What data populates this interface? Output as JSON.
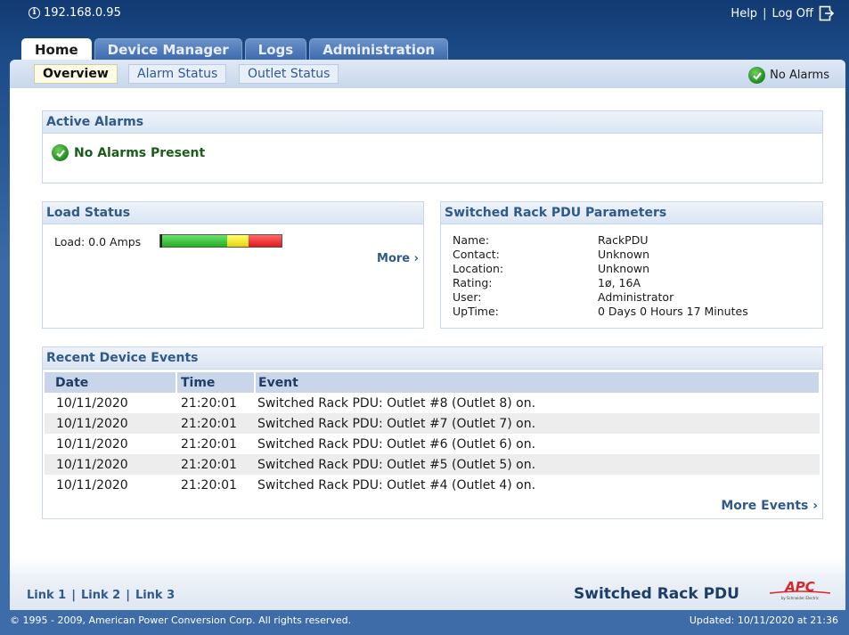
{
  "top": {
    "ip": "192.168.0.95",
    "help": "Help",
    "sep": "|",
    "logoff": "Log Off"
  },
  "tabs": [
    {
      "label": "Home"
    },
    {
      "label": "Device Manager"
    },
    {
      "label": "Logs"
    },
    {
      "label": "Administration"
    }
  ],
  "subtabs": [
    {
      "label": "Overview"
    },
    {
      "label": "Alarm Status"
    },
    {
      "label": "Outlet Status"
    }
  ],
  "alarm_indicator": "No Alarms",
  "active_alarms": {
    "title": "Active Alarms",
    "message": "No Alarms Present"
  },
  "load_status": {
    "title": "Load Status",
    "label": "Load: 0.0 Amps",
    "load_level": 0,
    "more": "More ›"
  },
  "parameters": {
    "title": "Switched Rack PDU Parameters",
    "rows": [
      {
        "key": "Name:",
        "value": "RackPDU"
      },
      {
        "key": "Contact:",
        "value": "Unknown"
      },
      {
        "key": "Location:",
        "value": "Unknown"
      },
      {
        "key": "Rating:",
        "value": "1ø, 16A"
      },
      {
        "key": "User:",
        "value": "Administrator"
      },
      {
        "key": "UpTime:",
        "value": "0 Days 0 Hours 17 Minutes"
      }
    ]
  },
  "events": {
    "title": "Recent Device Events",
    "headers": [
      "Date",
      "Time",
      "Event"
    ],
    "rows": [
      {
        "date": "10/11/2020",
        "time": "21:20:01",
        "event": "Switched Rack PDU: Outlet #8 (Outlet 8) on."
      },
      {
        "date": "10/11/2020",
        "time": "21:20:01",
        "event": "Switched Rack PDU: Outlet #7 (Outlet 7) on."
      },
      {
        "date": "10/11/2020",
        "time": "21:20:01",
        "event": "Switched Rack PDU: Outlet #6 (Outlet 6) on."
      },
      {
        "date": "10/11/2020",
        "time": "21:20:01",
        "event": "Switched Rack PDU: Outlet #5 (Outlet 5) on."
      },
      {
        "date": "10/11/2020",
        "time": "21:20:01",
        "event": "Switched Rack PDU: Outlet #4 (Outlet 4) on."
      }
    ],
    "more": "More Events ›"
  },
  "footer": {
    "links": [
      "Link 1",
      "Link 2",
      "Link 3"
    ],
    "link_sep": "|",
    "product": "Switched Rack PDU",
    "logo_text": "APC",
    "logo_sub": "by Schneider Electric",
    "copyright": "© 1995 - 2009, American Power Conversion Corp. All rights reserved.",
    "updated": "Updated: 10/11/2020 at 21:36"
  },
  "colors": {
    "header_bg": "#1b4a87",
    "accent": "#2f5a8a",
    "ok_green": "#1d8a1d",
    "logo_red": "#d9262b"
  }
}
